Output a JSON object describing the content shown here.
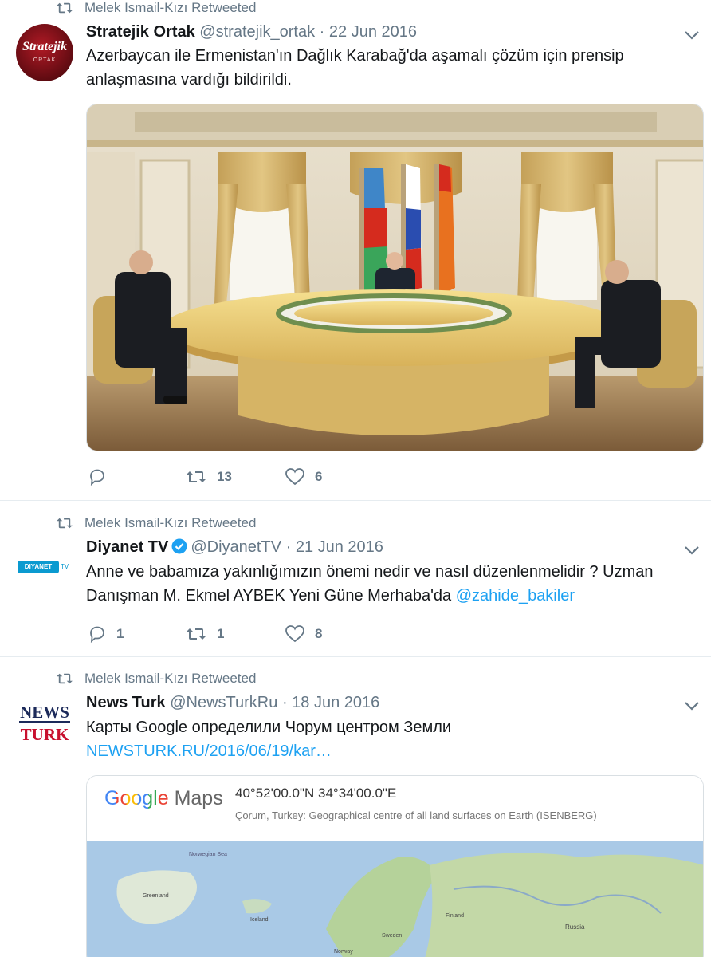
{
  "tweets": [
    {
      "retweeted_by": "Melek Ismail-Kızı Retweeted",
      "name": "Stratejik Ortak",
      "handle": "@stratejik_ortak",
      "separator": "·",
      "date": "22 Jun 2016",
      "avatar_text": "Stratejik",
      "avatar_sub": "ORTAK",
      "text": "Azerbaycan ile Ermenistan'ın Dağlık Karabağ'da aşamalı çözüm için prensip anlaşmasına vardığı bildirildi.",
      "reply_count": "",
      "retweet_count": "13",
      "like_count": "6"
    },
    {
      "retweeted_by": "Melek Ismail-Kızı Retweeted",
      "name": "Diyanet TV",
      "handle": "@DiyanetTV",
      "separator": "·",
      "date": "21 Jun 2016",
      "avatar_text": "DIYANET",
      "avatar_sub": "TV",
      "text": "Anne ve babamıza yakınlığımızın önemi nedir ve nasıl düzenlenmelidir ? Uzman Danışman M. Ekmel AYBEK Yeni Güne Merhaba'da ",
      "mention": "@zahide_bakiler",
      "reply_count": "1",
      "retweet_count": "1",
      "like_count": "8"
    },
    {
      "retweeted_by": "Melek Ismail-Kızı Retweeted",
      "name": "News Turk",
      "handle": "@NewsTurkRu",
      "separator": "·",
      "date": "18 Jun 2016",
      "avatar_text": "NEWS",
      "avatar_sub": "TURK",
      "text": "Карты Google определили Чорум центром Земли",
      "link": "NEWSTURK.RU/2016/06/19/kar…",
      "map": {
        "brand_google": "Google",
        "brand_maps": "Maps",
        "coords": "40°52'00.0\"N 34°34'00.0\"E",
        "subtitle": "Çorum, Turkey: Geographical centre of all land surfaces on Earth (ISENBERG)",
        "labels": [
          "Norwegian Sea",
          "Greenland",
          "Iceland",
          "Finland",
          "Sweden",
          "Norway",
          "Russia"
        ]
      }
    }
  ],
  "colors": {
    "link": "#1da1f2",
    "muted": "#657786",
    "verified": "#1da1f2",
    "news_red": "#c8102e",
    "news_navy": "#1c2a5a"
  }
}
